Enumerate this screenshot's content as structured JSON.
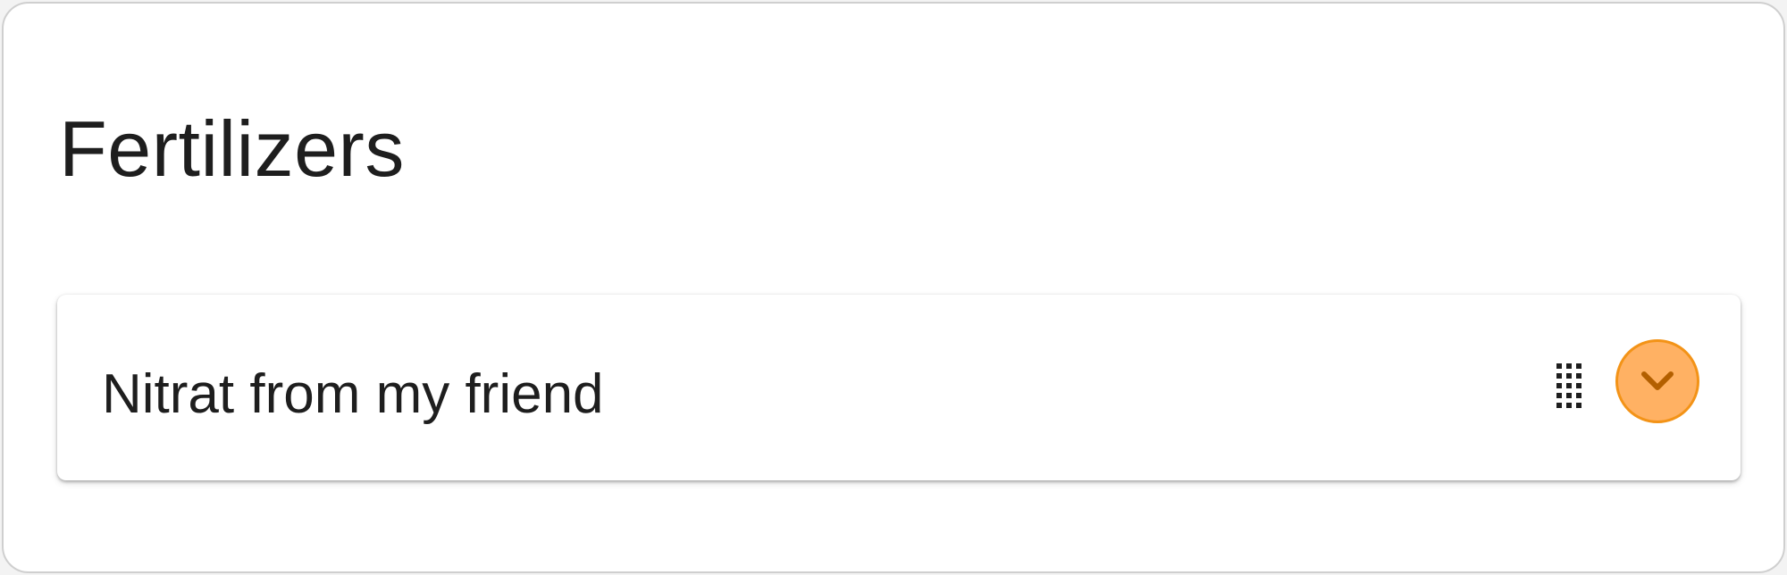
{
  "section": {
    "title": "Fertilizers"
  },
  "items": [
    {
      "label": "Nitrat from my friend",
      "drag_icon": "drag-handle-icon",
      "expand_icon": "chevron-down-icon"
    }
  ],
  "colors": {
    "accent_fill": "#ffb163",
    "accent_border": "#f39317",
    "accent_icon": "#b35f00",
    "text": "#1e1e1e"
  }
}
